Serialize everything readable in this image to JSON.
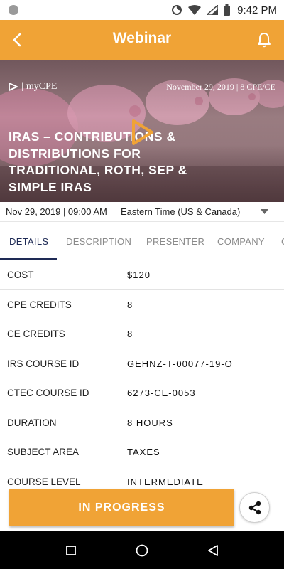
{
  "status_bar": {
    "time": "9:42 PM"
  },
  "app_bar": {
    "title": "Webinar"
  },
  "hero": {
    "brand": "myCPE",
    "date_credits": "November 29, 2019 | 8 CPE/CE",
    "title": "IRAs – Contributions & Distributions for Traditional, Roth, SEP & Simple IRAs"
  },
  "schedule": {
    "date_time": "Nov 29, 2019 | 09:00 AM",
    "timezone": "Eastern Time (US & Canada)"
  },
  "tabs": [
    {
      "label": "DETAILS",
      "active": true
    },
    {
      "label": "DESCRIPTION",
      "active": false
    },
    {
      "label": "PRESENTER",
      "active": false
    },
    {
      "label": "COMPANY",
      "active": false
    },
    {
      "label": "C",
      "active": false
    }
  ],
  "details": [
    {
      "label": "COST",
      "value": "$120"
    },
    {
      "label": "CPE CREDITS",
      "value": "8"
    },
    {
      "label": "CE CREDITS",
      "value": "8"
    },
    {
      "label": "IRS COURSE ID",
      "value": "GEHNZ-T-00077-19-O"
    },
    {
      "label": "CTEC COURSE ID",
      "value": "6273-CE-0053"
    },
    {
      "label": "DURATION",
      "value": "8 HOURS"
    },
    {
      "label": "SUBJECT AREA",
      "value": "TAXES"
    },
    {
      "label": "COURSE LEVEL",
      "value": "INTERMEDIATE"
    }
  ],
  "action": {
    "primary_label": "IN PROGRESS"
  },
  "colors": {
    "accent": "#f0a336",
    "tab_active": "#1e2a55"
  }
}
